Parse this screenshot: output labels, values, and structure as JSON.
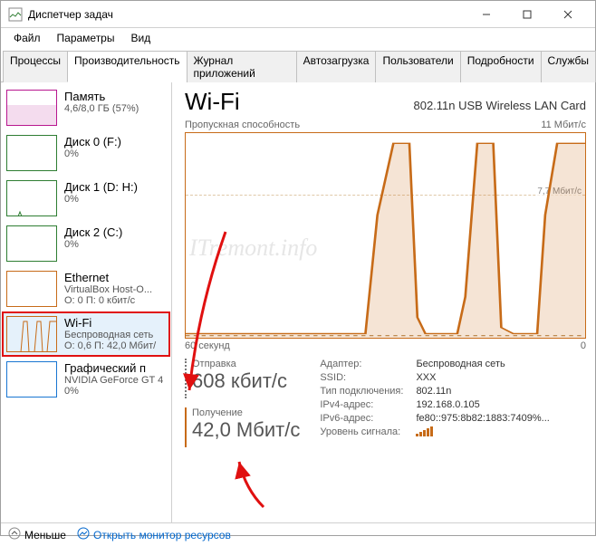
{
  "title": "Диспетчер задач",
  "menu": {
    "file": "Файл",
    "options": "Параметры",
    "view": "Вид"
  },
  "tabs": [
    "Процессы",
    "Производительность",
    "Журнал приложений",
    "Автозагрузка",
    "Пользователи",
    "Подробности",
    "Службы"
  ],
  "activeTab": 1,
  "sidebar": {
    "items": [
      {
        "name": "Память",
        "sub": "4,6/8,0 ГБ (57%)",
        "type": "memory"
      },
      {
        "name": "Диск 0 (F:)",
        "sub": "0%",
        "type": "disk"
      },
      {
        "name": "Диск 1 (D: H:)",
        "sub": "0%",
        "type": "disk"
      },
      {
        "name": "Диск 2 (C:)",
        "sub": "0%",
        "type": "disk"
      },
      {
        "name": "Ethernet",
        "sub": "VirtualBox Host-O...",
        "sub2": "О: 0 П: 0 кбит/с",
        "type": "eth"
      },
      {
        "name": "Wi-Fi",
        "sub": "Беспроводная сеть",
        "sub2": "О: 0,6 П: 42,0 Мбит/",
        "type": "wifi"
      },
      {
        "name": "Графический п",
        "sub": "NVIDIA GeForce GT 4",
        "sub2": "0%",
        "type": "gpu"
      }
    ],
    "selected": 5
  },
  "main": {
    "title": "Wi-Fi",
    "adapter": "802.11n USB Wireless LAN Card",
    "chart_top_left": "Пропускная способность",
    "chart_top_right": "11 Мбит/с",
    "chart_mid_label": "7,7 Мбит/с",
    "chart_bottom_left": "60 секунд",
    "chart_bottom_right": "0",
    "watermark": "ITremont.info",
    "send": {
      "label": "Отправка",
      "value": "608 кбит/с"
    },
    "recv": {
      "label": "Получение",
      "value": "42,0 Мбит/с"
    },
    "info": {
      "adapter_k": "Адаптер:",
      "adapter_v": "Беспроводная сеть",
      "ssid_k": "SSID:",
      "ssid_v": "XXX",
      "conn_k": "Тип подключения:",
      "conn_v": "802.11n",
      "ipv4_k": "IPv4-адрес:",
      "ipv4_v": "192.168.0.105",
      "ipv6_k": "IPv6-адрес:",
      "ipv6_v": "fe80::975:8b82:1883:7409%...",
      "sig_k": "Уровень сигнала:"
    }
  },
  "footer": {
    "less": "Меньше",
    "monitor": "Открыть монитор ресурсов"
  },
  "chart_data": {
    "type": "line",
    "title": "Пропускная способность Wi-Fi",
    "xlabel": "Секунды",
    "ylabel": "Мбит/с",
    "xlim": [
      60,
      0
    ],
    "ylim": [
      0,
      11
    ],
    "series": [
      {
        "name": "Получение",
        "values": [
          0.3,
          0.3,
          0.3,
          0.3,
          0.3,
          0.3,
          0.3,
          0.3,
          0.3,
          0.3,
          0.3,
          0.3,
          0.3,
          0.3,
          0.3,
          0.3,
          0.3,
          0.3,
          0.3,
          6,
          9,
          10.5,
          10.5,
          1,
          0.4,
          0.4,
          0.4,
          0.4,
          0.4,
          2,
          9,
          10.5,
          10.5,
          0.5,
          0.4,
          0.4,
          0.4,
          0.4,
          6,
          10.5,
          10.5
        ]
      },
      {
        "name": "Отправка",
        "values": [
          0.1,
          0.1,
          0.1,
          0.1,
          0.1,
          0.1,
          0.1,
          0.1,
          0.1,
          0.1,
          0.1,
          0.1,
          0.1,
          0.1,
          0.1,
          0.1,
          0.1,
          0.1,
          0.1,
          0.2,
          0.3,
          0.3,
          0.3,
          0.15,
          0.1,
          0.1,
          0.1,
          0.1,
          0.1,
          0.2,
          0.3,
          0.3,
          0.3,
          0.1,
          0.1,
          0.1,
          0.1,
          0.1,
          0.2,
          0.3,
          0.3
        ]
      }
    ],
    "annotations": [
      {
        "label": "7,7 Мбит/с",
        "y": 7.7
      }
    ]
  }
}
